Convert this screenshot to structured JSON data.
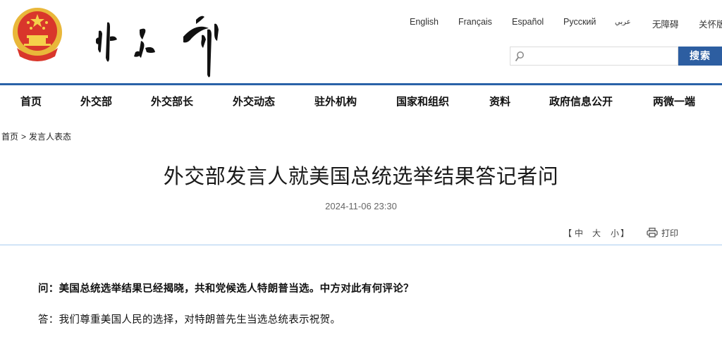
{
  "header": {
    "site_logo_text": "外交部",
    "emblem_alt": "national-emblem",
    "languages": [
      {
        "label": "English"
      },
      {
        "label": "Français"
      },
      {
        "label": "Español"
      },
      {
        "label": "Русский"
      },
      {
        "label": "عربي"
      },
      {
        "label": "无障碍"
      },
      {
        "label": "关怀版"
      }
    ],
    "search": {
      "placeholder": "",
      "value": "",
      "button_label": "搜索"
    }
  },
  "nav": {
    "items": [
      {
        "label": "首页"
      },
      {
        "label": "外交部"
      },
      {
        "label": "外交部长"
      },
      {
        "label": "外交动态"
      },
      {
        "label": "驻外机构"
      },
      {
        "label": "国家和组织"
      },
      {
        "label": "资料"
      },
      {
        "label": "政府信息公开"
      },
      {
        "label": "两微一端"
      }
    ]
  },
  "breadcrumb": {
    "items": [
      {
        "label": "首页"
      },
      {
        "label": "发言人表态"
      }
    ],
    "separator": ">"
  },
  "article": {
    "title": "外交部发言人就美国总统选举结果答记者问",
    "date": "2024-11-06 23:30",
    "font_size_controls": {
      "open_bracket": "【",
      "medium": "中",
      "large": "大",
      "small": "小",
      "close_bracket": "】"
    },
    "print_label": "打印",
    "question": "问：美国总统选举结果已经揭晓，共和党候选人特朗普当选。中方对此有何评论？",
    "answer": "答：我们尊重美国人民的选择，对特朗普先生当选总统表示祝贺。"
  },
  "colors": {
    "brand_blue": "#2a62a8",
    "search_button": "#2d5ea1",
    "divider_light": "#a9cdef"
  }
}
